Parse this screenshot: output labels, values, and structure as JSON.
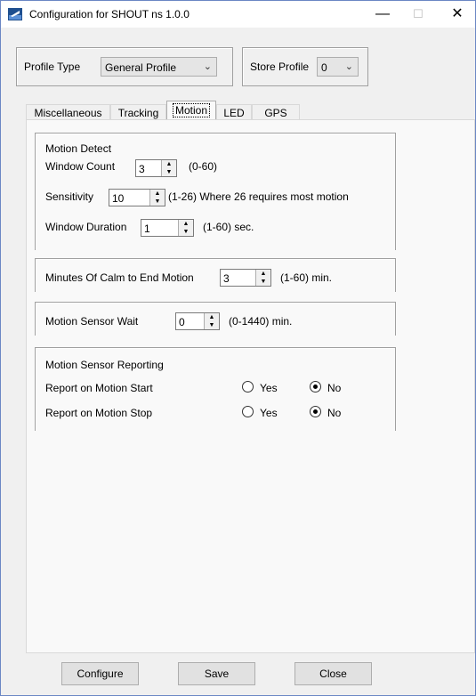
{
  "window": {
    "title": "Configuration for SHOUT ns 1.0.0",
    "minimize": "—",
    "maximize": "☐",
    "close": "✕"
  },
  "profile_type": {
    "label": "Profile Type",
    "value": "General Profile"
  },
  "store_profile": {
    "label": "Store Profile",
    "value": "0"
  },
  "tabs": [
    "Miscellaneous",
    "Tracking",
    "Motion",
    "LED",
    "GPS"
  ],
  "motion_detect": {
    "title": "Motion Detect",
    "window_count": {
      "label": "Window Count",
      "value": "3",
      "range": "(0-60)"
    },
    "sensitivity": {
      "label": "Sensitivity",
      "value": "10",
      "range": "(1-26) Where 26 requires most motion"
    },
    "window_duration": {
      "label": "Window Duration",
      "value": "1",
      "range": "(1-60) sec."
    }
  },
  "calm": {
    "label": "Minutes Of Calm to End Motion",
    "value": "3",
    "range": "(1-60) min."
  },
  "sensor_wait": {
    "label": "Motion Sensor Wait",
    "value": "0",
    "range": "(0-1440) min."
  },
  "reporting": {
    "title": "Motion Sensor Reporting",
    "start": {
      "label": "Report on Motion Start",
      "yes": "Yes",
      "no": "No",
      "selected": "No"
    },
    "stop": {
      "label": "Report on Motion Stop",
      "yes": "Yes",
      "no": "No",
      "selected": "No"
    }
  },
  "buttons": {
    "configure": "Configure",
    "save": "Save",
    "close": "Close"
  },
  "colors": {
    "window_bg": "#f0f0f0",
    "panel_bg": "#f9f9f9",
    "border": "#a0a0a0",
    "accent": "#6b87c4"
  }
}
